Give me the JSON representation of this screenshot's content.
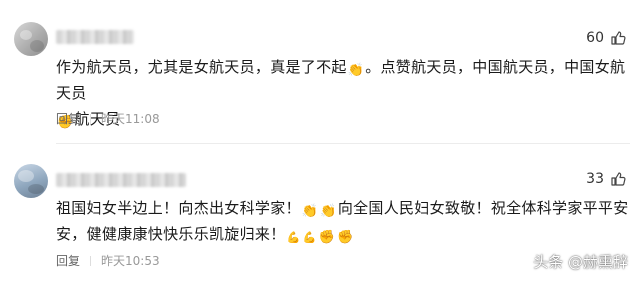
{
  "comments": [
    {
      "likes": "60",
      "text_parts": [
        "作为航天员，尤其是女航天员，真是了不起",
        "。点赞航天员，中国航天员，中国女航天员",
        "航天员"
      ],
      "reply_label": "回复",
      "timestamp": "昨天11:08"
    },
    {
      "likes": "33",
      "text_parts": [
        "祖国妇女半边上！向杰出女科学家！",
        "向全国人民妇女致敬！祝全体科学家平平安安，健健康康快快乐乐凯旋归来！"
      ],
      "reply_label": "回复",
      "timestamp": "昨天10:53"
    }
  ],
  "watermark": "头条 @赫熏辞",
  "icons": {
    "like": "thumbs-up-icon",
    "clap": "clapping-hands-icon",
    "fist": "raised-fist-icon",
    "flex": "fighting-icon"
  },
  "colors": {
    "text": "#1a1a1a",
    "meta": "#999999",
    "accent_red": "#e64a4a"
  }
}
